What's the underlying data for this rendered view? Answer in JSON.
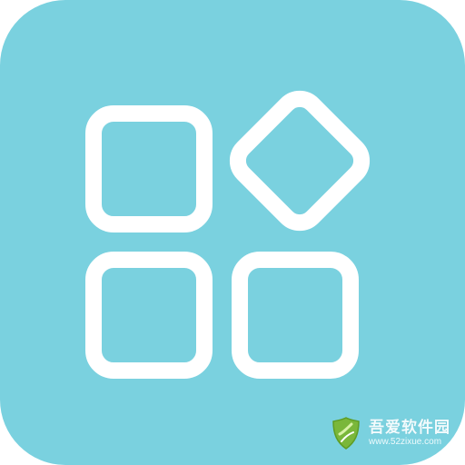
{
  "icon": {
    "background_color": "#7ad1df",
    "glyph_color": "#ffffff",
    "glyph_name": "apps-grid-icon"
  },
  "watermark": {
    "title": "吾爱软件园",
    "url": "www.52zixue.com",
    "logo_color": "#7ab73a"
  }
}
